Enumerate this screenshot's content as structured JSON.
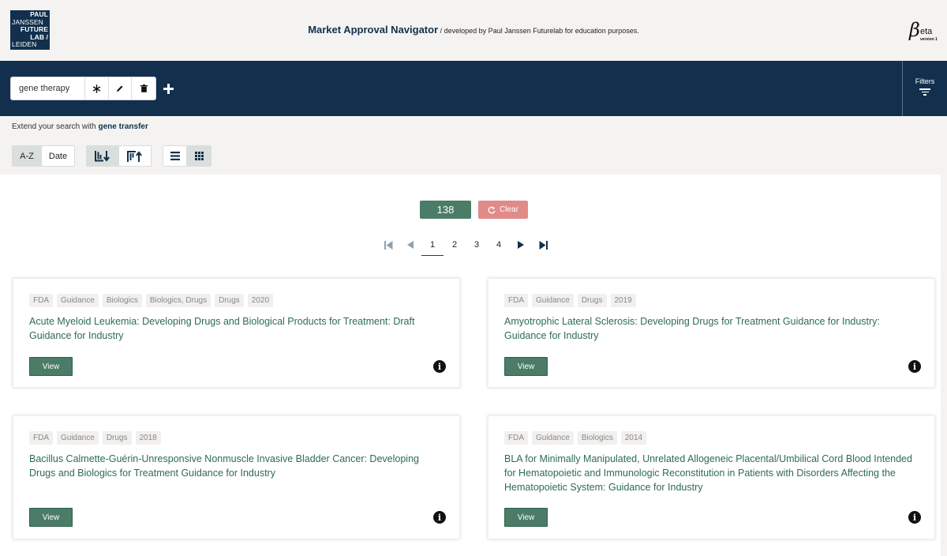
{
  "header": {
    "logo_lines": [
      "PAUL",
      "JANSSEN",
      "FUTURE",
      "LAB /",
      "LEIDEN"
    ],
    "title": "Market Approval Navigator",
    "subtitle": " / developed by Paul Janssen Futurelab for education purposes.",
    "beta_mark": "β",
    "beta_label": "eta",
    "beta_version": "version 1"
  },
  "search": {
    "term": "gene therapy",
    "add_icon": "plus-icon",
    "actions": [
      "asterisk-icon",
      "pencil-icon",
      "trash-icon"
    ]
  },
  "filters": {
    "label": "Filters"
  },
  "extend": {
    "prefix": "Extend your search with ",
    "term": "gene transfer"
  },
  "sort": {
    "az": "A-Z",
    "date": "Date",
    "active": "A-Z"
  },
  "results": {
    "count": "138",
    "clear_label": "Clear",
    "pages": [
      "1",
      "2",
      "3",
      "4"
    ],
    "current_page": "1",
    "cards": [
      {
        "tags": [
          "FDA",
          "Guidance",
          "Biologics",
          "Biologics, Drugs",
          "Drugs",
          "2020"
        ],
        "title": "Acute Myeloid Leukemia: Developing Drugs and Biological Products for Treatment: Draft Guidance for Industry",
        "view_label": "View"
      },
      {
        "tags": [
          "FDA",
          "Guidance",
          "Drugs",
          "2019"
        ],
        "title": "Amyotrophic Lateral Sclerosis: Developing Drugs for Treatment Guidance for Industry: Guidance for Industry",
        "view_label": "View"
      },
      {
        "tags": [
          "FDA",
          "Guidance",
          "Drugs",
          "2018"
        ],
        "title": "Bacillus Calmette-Guérin-Unresponsive Nonmuscle Invasive Bladder Cancer: Developing Drugs and Biologics for Treatment Guidance for Industry",
        "view_label": "View"
      },
      {
        "tags": [
          "FDA",
          "Guidance",
          "Biologics",
          "2014"
        ],
        "title": "BLA for Minimally Manipulated, Unrelated Allogeneic Placental/Umbilical Cord Blood Intended for Hematopoietic and Immunologic Reconstitution in Patients with Disorders Affecting the Hematopoietic System: Guidance for Industry",
        "view_label": "View"
      }
    ]
  },
  "colors": {
    "navy": "#12304d",
    "green": "#4b7c67",
    "clear": "#e08b89",
    "title_green": "#2e6b52"
  }
}
